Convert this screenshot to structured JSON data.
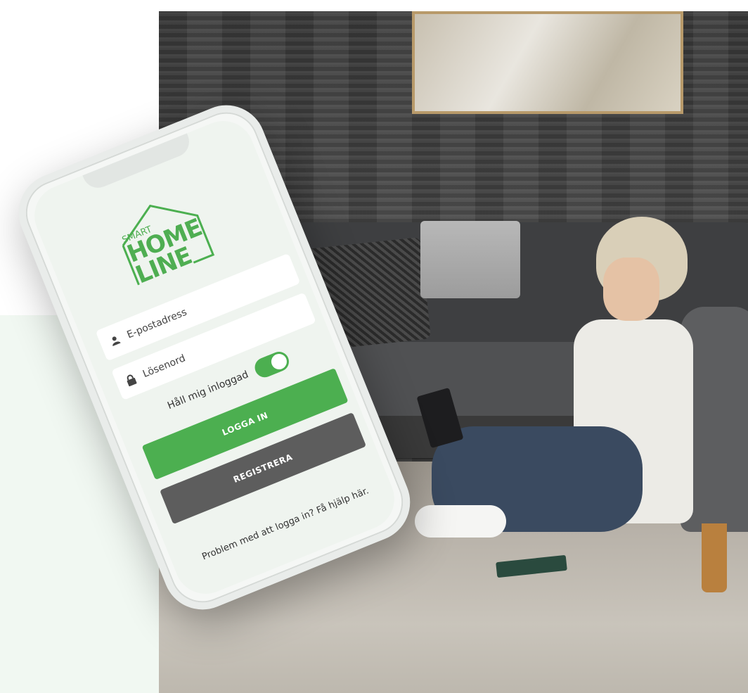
{
  "logo": {
    "small": "SMART",
    "home": "HOME",
    "line": "LINE"
  },
  "login": {
    "email_placeholder": "E-postadress",
    "password_placeholder": "Lösenord",
    "remember_label": "Håll mig inloggad",
    "remember_on": true,
    "login_button": "LOGGA IN",
    "register_button": "REGISTRERA",
    "help_text": "Problem med att logga in? Få hjälp här."
  },
  "colors": {
    "brand_green": "#4caf50",
    "register_gray": "#5d5d5d",
    "mint_panel": "#f1f8f2"
  }
}
